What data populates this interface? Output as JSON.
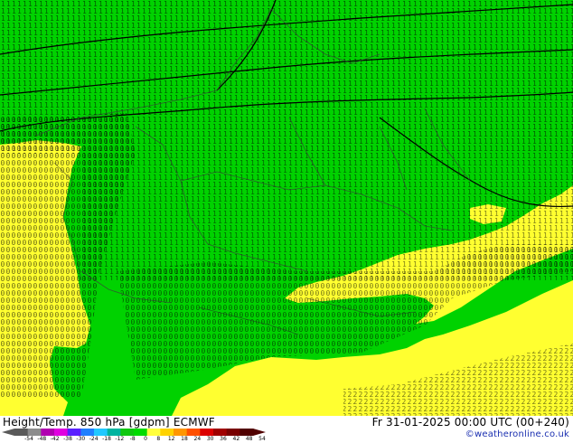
{
  "footer": {
    "title": "Height/Temp. 850 hPa [gdpm] ECMWF",
    "datetime": "Fr 31-01-2025 00:00 UTC (00+240)",
    "credit": "©weatheronline.co.uk"
  },
  "legend": {
    "ticks": [
      "-54",
      "-48",
      "-42",
      "-38",
      "-30",
      "-24",
      "-18",
      "-12",
      "-8",
      "0",
      "8",
      "12",
      "18",
      "24",
      "30",
      "36",
      "42",
      "48",
      "54"
    ],
    "colors": [
      "#5a5a5a",
      "#8c8c8c",
      "#b000b0",
      "#e000e0",
      "#5a20ff",
      "#2080ff",
      "#20c8ff",
      "#00b4a0",
      "#10c810",
      "#00dc00",
      "#ffff3c",
      "#ffd200",
      "#ff9600",
      "#ff5000",
      "#dc0000",
      "#a00000",
      "#780000",
      "#500000"
    ]
  },
  "map": {
    "colors": {
      "green": "#00d200",
      "yellow": "#ffff30",
      "contour": "#000000",
      "border": "#3c3c3c"
    }
  }
}
